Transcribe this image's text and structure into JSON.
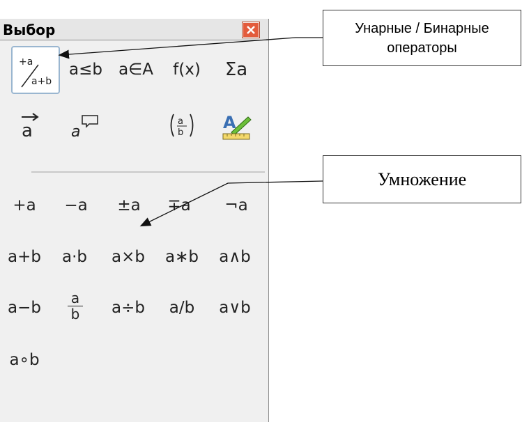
{
  "window": {
    "title": "Выбор"
  },
  "callouts": {
    "unary_binary": "Унарные / Бинарные операторы",
    "multiplication": "Умножение"
  },
  "categories": {
    "unary_binary_operators": "+a/a+b",
    "relations": "a≤b",
    "set_operations": "a∈A",
    "functions": "f(x)",
    "operators": "Σa",
    "attributes": "a⃗",
    "others": "a",
    "brackets": "(a/b)",
    "formats": "A"
  },
  "operators": [
    [
      "+a",
      "−a",
      "±a",
      "∓a",
      "¬a"
    ],
    [
      "a+b",
      "a·b",
      "a×b",
      "a∗b",
      "a∧b"
    ],
    [
      "a−b",
      "a/b fraction",
      "a÷b",
      "a/b",
      "a∨b"
    ],
    [
      "a∘b"
    ]
  ],
  "display": {
    "r0": [
      "+a",
      "−a",
      "±a",
      "∓a",
      "¬a"
    ],
    "r1": [
      "a+b",
      "a·b",
      "a×b",
      "a∗b",
      "a∧b"
    ],
    "r2": [
      "a−b",
      "a",
      "b",
      "a÷b",
      "a/b",
      "a∨b"
    ],
    "r3": [
      "a∘b"
    ]
  }
}
